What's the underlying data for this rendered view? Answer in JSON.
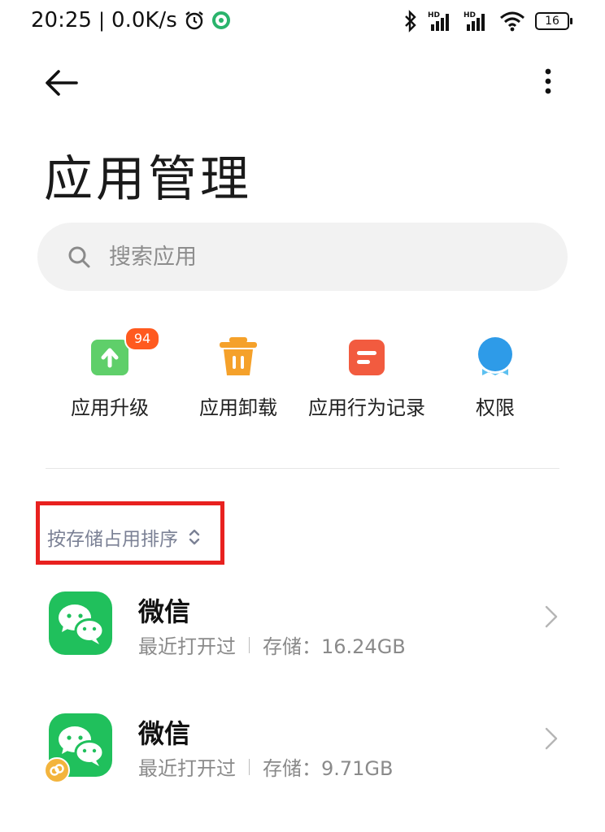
{
  "status_bar": {
    "time": "20:25",
    "network_speed": "0.0K/s",
    "icons": [
      "alarm-icon",
      "app-notification-icon",
      "bluetooth-icon",
      "hd-signal-icon",
      "hd-signal-icon",
      "wifi-icon"
    ],
    "battery": "16"
  },
  "header": {
    "back_icon": "back-arrow-icon",
    "more_icon": "more-vertical-icon"
  },
  "page": {
    "title": "应用管理"
  },
  "search": {
    "placeholder": "搜索应用",
    "value": ""
  },
  "quick_actions": [
    {
      "label": "应用升级",
      "icon": "upgrade-icon",
      "badge": "94",
      "color": "#5fcf6a"
    },
    {
      "label": "应用卸载",
      "icon": "trash-icon",
      "color": "#f5a12a"
    },
    {
      "label": "应用行为记录",
      "icon": "behavior-record-icon",
      "color": "#f25b3f"
    },
    {
      "label": "权限",
      "icon": "permission-icon",
      "color": "#2e9be8"
    }
  ],
  "sort": {
    "label": "按存储占用排序"
  },
  "apps": [
    {
      "name": "微信",
      "last_opened": "最近打开过",
      "storage": "存储：16.24GB"
    },
    {
      "name": "微信",
      "last_opened": "最近打开过",
      "storage": "存储：9.71GB"
    }
  ],
  "colors": {
    "accent_green": "#20c05c",
    "highlight_red": "#e8211f",
    "sort_text": "#7b8195"
  }
}
